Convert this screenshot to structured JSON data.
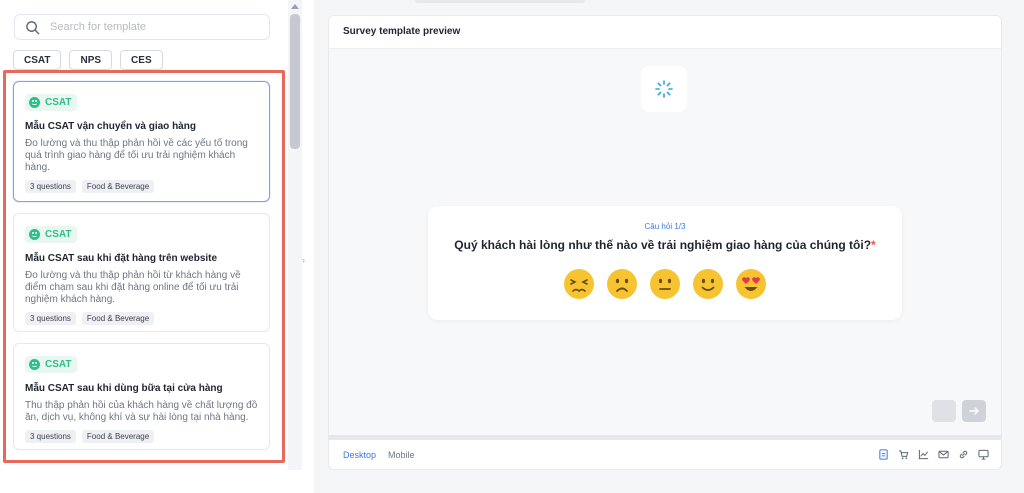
{
  "search": {
    "placeholder": "Search for template"
  },
  "filters": [
    "CSAT",
    "NPS",
    "CES"
  ],
  "templates": [
    {
      "badge": "CSAT",
      "title": "Mẫu CSAT vận chuyển và giao hàng",
      "description": "Đo lường và thu thập phản hồi về các yếu tố trong quá trình giao hàng để tối ưu trải nghiệm khách hàng.",
      "questions": "3 questions",
      "category": "Food & Beverage"
    },
    {
      "badge": "CSAT",
      "title": "Mẫu CSAT sau khi đặt hàng trên website",
      "description": "Đo lường và thu thập phản hồi từ khách hàng về điểm chạm sau khi đặt hàng online để tối ưu trải nghiệm khách hàng.",
      "questions": "3 questions",
      "category": "Food & Beverage"
    },
    {
      "badge": "CSAT",
      "title": "Mẫu CSAT sau khi dùng bữa tại cửa hàng",
      "description": "Thu thập phản hồi của khách hàng về chất lượng đồ ăn, dịch vụ, không khí và sự hài lòng tại nhà hàng.",
      "questions": "3 questions",
      "category": "Food & Beverage"
    }
  ],
  "preview": {
    "title": "Survey template preview",
    "question_counter": "Câu hỏi 1/3",
    "question_text": "Quý khách hài lòng như thế nào về trải nghiệm giao hàng của chúng tôi?",
    "required_mark": "*",
    "rating_scale": [
      "very-dissatisfied",
      "dissatisfied",
      "neutral",
      "satisfied",
      "very-satisfied"
    ]
  },
  "footer": {
    "tabs": [
      "Desktop",
      "Mobile"
    ],
    "active_tab": "Desktop",
    "channel_icons": [
      "web-survey-icon",
      "cart-icon",
      "chart-icon",
      "email-icon",
      "link-icon",
      "monitor-icon"
    ]
  },
  "colors": {
    "accent": "#3a7be0",
    "csat_green": "#2bbf8a",
    "highlight": "#e8685a",
    "selected_border": "#7f9fe6"
  }
}
